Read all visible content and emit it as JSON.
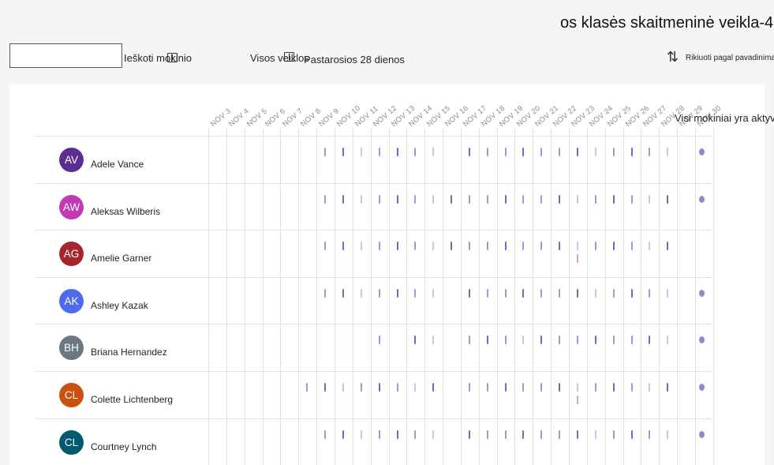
{
  "header": {
    "title": "os klasės skaitmeninė veikla-4",
    "search_label": "Ieškoti mokinio",
    "filter_label": "Visos veiklos",
    "period_label": "Pastarosios 28 dienos",
    "sort_label": "Rikiuoti pagal pavadinimą"
  },
  "summary": {
    "all_active": "Visi mokiniai yra aktyvūs"
  },
  "dates": [
    "NOV 3",
    "NOV 4",
    "NOV 5",
    "NOV 6",
    "NOV 7",
    "NOV 8",
    "NOV 9",
    "NOV 10",
    "NOV 11",
    "NOV 12",
    "NOV 13",
    "NOV 14",
    "NOV 15",
    "NOV 16",
    "NOV 17",
    "NOV 18",
    "NOV 19",
    "NOV 20",
    "NOV 21",
    "NOV 22",
    "NOV 23",
    "NOV 24",
    "NOV 25",
    "NOV 26",
    "NOV 27",
    "NOV 28",
    "NOV 29",
    "NOV 30"
  ],
  "students": [
    {
      "initials": "AV",
      "name": "Adele Vance",
      "color": "#5c2e91"
    },
    {
      "initials": "AW",
      "name": "Aleksas Wilberis",
      "color": "#c239b3"
    },
    {
      "initials": "AG",
      "name": "Amelie Garner",
      "color": "#a4262c"
    },
    {
      "initials": "AK",
      "name": "Ashley Kazak",
      "color": "#4f6bed"
    },
    {
      "initials": "BH",
      "name": "Briana Hernandez",
      "color": "#69797e"
    },
    {
      "initials": "CL",
      "name": "Colette Lichtenberg",
      "color": "#ca5010"
    },
    {
      "initials": "CL",
      "name": "Courtney Lynch",
      "color": "#005b70"
    }
  ],
  "colors": {
    "activity": "#9a9bd6",
    "activity_dark": "#6a6bc2",
    "alert": "#e7a0a0"
  },
  "icons": {
    "sort": "sort-arrows-icon",
    "columns": "column-toggle-icon"
  }
}
